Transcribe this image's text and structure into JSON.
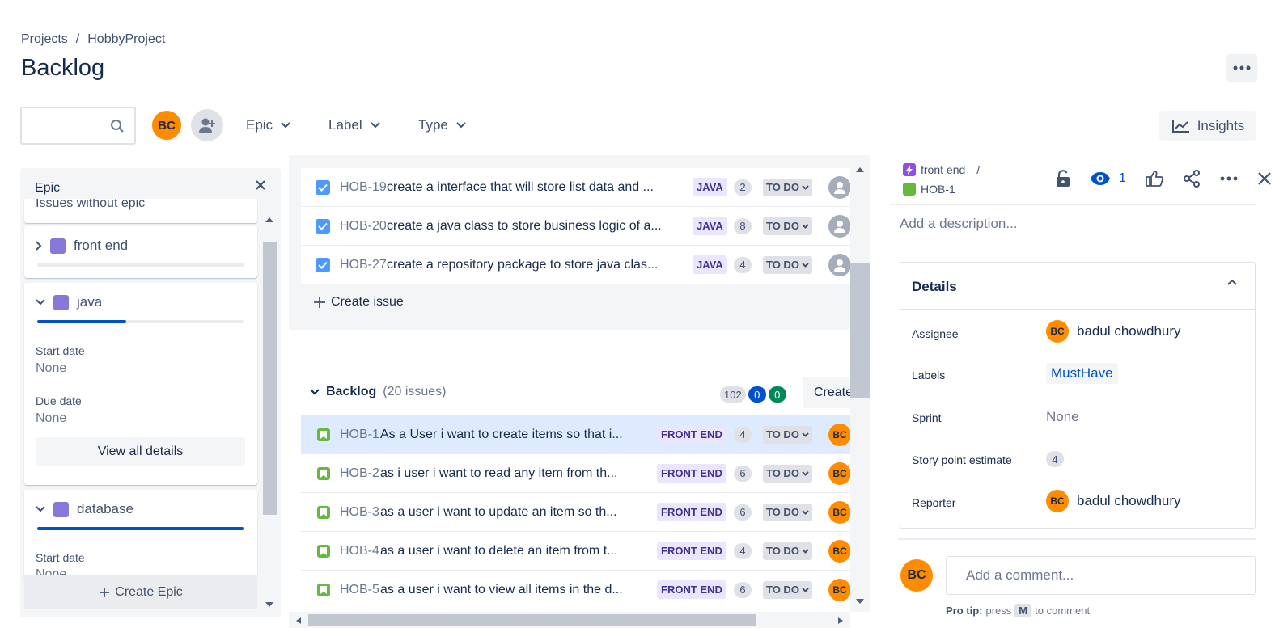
{
  "breadcrumb": {
    "projects": "Projects",
    "separator": "/",
    "project": "HobbyProject"
  },
  "page": {
    "title": "Backlog"
  },
  "filters": {
    "search_placeholder": "",
    "user_initials": "BC",
    "epic": "Epic",
    "label": "Label",
    "type": "Type",
    "insights": "Insights"
  },
  "epic_panel": {
    "title": "Epic",
    "partial_item": "Issues without epic",
    "epics": [
      {
        "name": "front end",
        "progress": 0
      },
      {
        "name": "java",
        "progress": 0.43,
        "start_label": "Start date",
        "start_value": "None",
        "due_label": "Due date",
        "due_value": "None",
        "view_all": "View all details"
      },
      {
        "name": "database",
        "progress": 1.0,
        "start_label": "Start date",
        "start_value": "None"
      }
    ],
    "create_epic": "Create Epic"
  },
  "sprint_issues": [
    {
      "key": "HOB-19",
      "summary": "create a interface that will store list data and ...",
      "label": "JAVA",
      "points": "2",
      "status": "TO DO"
    },
    {
      "key": "HOB-20",
      "summary": "create a java class to store business logic of a...",
      "label": "JAVA",
      "points": "8",
      "status": "TO DO"
    },
    {
      "key": "HOB-27",
      "summary": "create a repository package to store java clas...",
      "label": "JAVA",
      "points": "4",
      "status": "TO DO"
    }
  ],
  "create_issue": "Create issue",
  "backlog": {
    "title": "Backlog",
    "count": "(20 issues)",
    "counts": {
      "todo": "102",
      "in_progress": "0",
      "done": "0"
    },
    "create": "Create",
    "issues": [
      {
        "key": "HOB-1",
        "summary": "As a User i want to create items so that i...",
        "label": "FRONT END",
        "points": "4",
        "status": "TO DO",
        "assignee": "BC"
      },
      {
        "key": "HOB-2",
        "summary": "as i user i want to read any item from th...",
        "label": "FRONT END",
        "points": "6",
        "status": "TO DO",
        "assignee": "BC"
      },
      {
        "key": "HOB-3",
        "summary": "as a user i want to update an item so th...",
        "label": "FRONT END",
        "points": "6",
        "status": "TO DO",
        "assignee": "BC"
      },
      {
        "key": "HOB-4",
        "summary": "as a user i want to delete an item from t...",
        "label": "FRONT END",
        "points": "4",
        "status": "TO DO",
        "assignee": "BC"
      },
      {
        "key": "HOB-5",
        "summary": "as a user i want to view all items in the d...",
        "label": "FRONT END",
        "points": "6",
        "status": "TO DO",
        "assignee": "BC"
      }
    ]
  },
  "detail": {
    "epic": "front end",
    "separator": "/",
    "issue_key": "HOB-1",
    "watchers": "1",
    "description_placeholder": "Add a description...",
    "details_title": "Details",
    "assignee_label": "Assignee",
    "assignee_initials": "BC",
    "assignee_name": "badul chowdhury",
    "labels_label": "Labels",
    "label_value": "MustHave",
    "sprint_label": "Sprint",
    "sprint_value": "None",
    "story_points_label": "Story point estimate",
    "story_points_value": "4",
    "reporter_label": "Reporter",
    "reporter_initials": "BC",
    "reporter_name": "badul chowdhury",
    "comment_initials": "BC",
    "comment_placeholder": "Add a comment...",
    "tip_prefix": "Pro tip:",
    "tip_press": "press",
    "tip_key": "M",
    "tip_suffix": "to comment"
  },
  "colors": {
    "accent": "#0052cc",
    "avatar": "#ff8b00",
    "epic": "#8777d9",
    "story": "#63ba3c"
  }
}
